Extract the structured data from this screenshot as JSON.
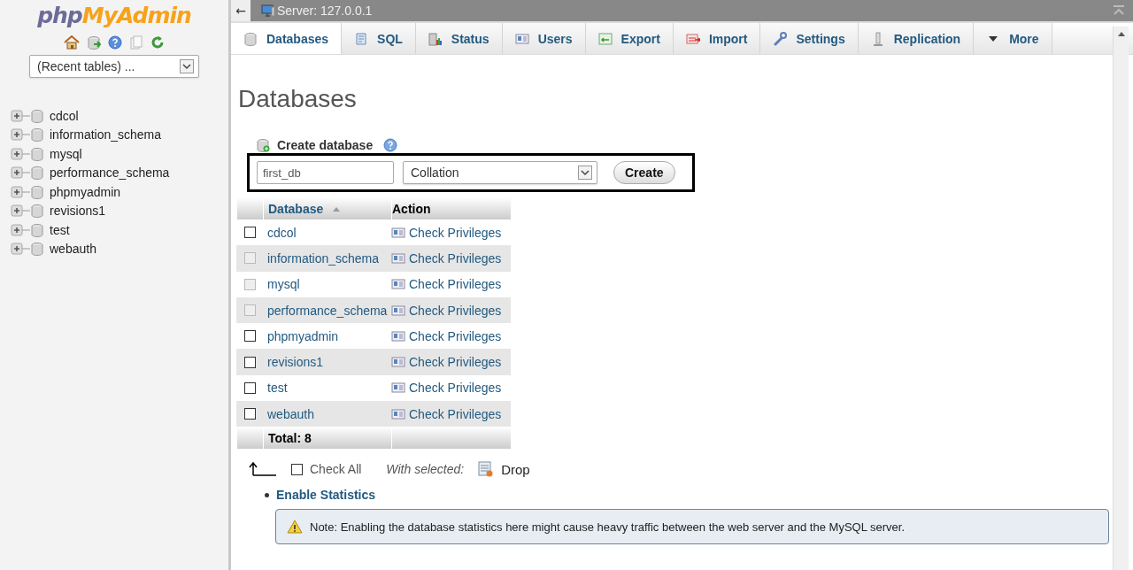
{
  "sidebar": {
    "logo": {
      "prefix": "php",
      "name": "MyAdmin"
    },
    "recent_tables": {
      "value": "(Recent tables) ..."
    },
    "databases": [
      {
        "name": "cdcol",
        "expanded": false
      },
      {
        "name": "information_schema",
        "expanded": false
      },
      {
        "name": "mysql",
        "expanded": false
      },
      {
        "name": "performance_schema",
        "expanded": false
      },
      {
        "name": "phpmyadmin",
        "expanded": false
      },
      {
        "name": "revisions1",
        "expanded": false
      },
      {
        "name": "test",
        "expanded": false
      },
      {
        "name": "webauth",
        "expanded": false
      }
    ]
  },
  "topbar": {
    "back": "←",
    "server": "Server: 127.0.0.1"
  },
  "tabs": [
    {
      "label": "Databases",
      "selected": true
    },
    {
      "label": "SQL",
      "selected": false
    },
    {
      "label": "Status",
      "selected": false
    },
    {
      "label": "Users",
      "selected": false
    },
    {
      "label": "Export",
      "selected": false
    },
    {
      "label": "Import",
      "selected": false
    },
    {
      "label": "Settings",
      "selected": false
    },
    {
      "label": "Replication",
      "selected": false
    },
    {
      "label": "More",
      "selected": false
    }
  ],
  "page_title": "Databases",
  "create": {
    "label": "Create database",
    "name_value": "first_db",
    "collation": "Collation",
    "button": "Create"
  },
  "table": {
    "columns": [
      "Database",
      "Action"
    ],
    "rows": [
      {
        "name": "cdcol",
        "action": "Check Privileges",
        "checked": false,
        "disabled": false
      },
      {
        "name": "information_schema",
        "action": "Check Privileges",
        "checked": false,
        "disabled": true
      },
      {
        "name": "mysql",
        "action": "Check Privileges",
        "checked": false,
        "disabled": true
      },
      {
        "name": "performance_schema",
        "action": "Check Privileges",
        "checked": false,
        "disabled": true
      },
      {
        "name": "phpmyadmin",
        "action": "Check Privileges",
        "checked": false,
        "disabled": false
      },
      {
        "name": "revisions1",
        "action": "Check Privileges",
        "checked": false,
        "disabled": false
      },
      {
        "name": "test",
        "action": "Check Privileges",
        "checked": false,
        "disabled": false
      },
      {
        "name": "webauth",
        "action": "Check Privileges",
        "checked": false,
        "disabled": false
      }
    ],
    "total": "Total: 8"
  },
  "bulk": {
    "check_all": "Check All",
    "checked": false,
    "with_selected": "With selected:",
    "drop": "Drop"
  },
  "enable_statistics": "Enable Statistics",
  "note": "Note: Enabling the database statistics here might cause heavy traffic between the web server and the MySQL server."
}
